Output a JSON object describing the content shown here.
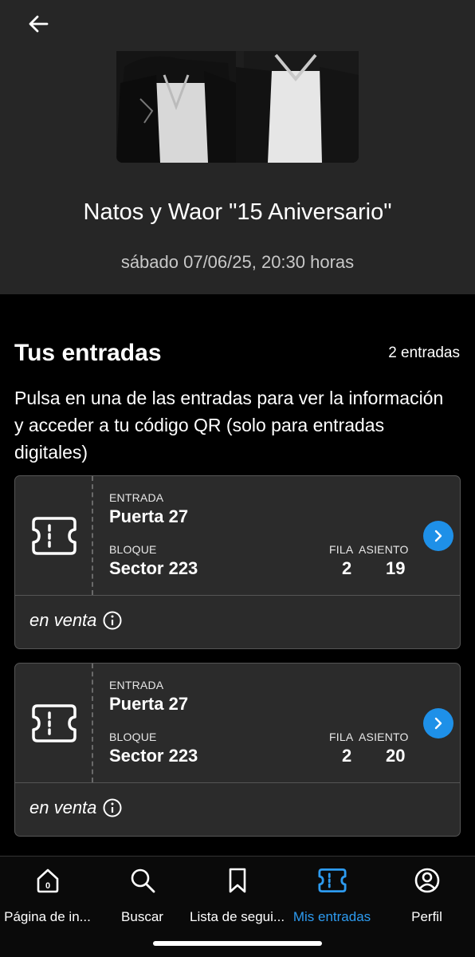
{
  "header": {
    "event_title": "Natos y Waor \"15 Aniversario\"",
    "event_date": "sábado 07/06/25, 20:30 horas"
  },
  "tickets_section": {
    "title": "Tus entradas",
    "count": "2 entradas",
    "instructions": "Pulsa en una de las entradas para ver la información y acceder a tu código QR (solo para entradas digitales)"
  },
  "tickets": [
    {
      "entrada_label": "ENTRADA",
      "entrada_value": "Puerta 27",
      "bloque_label": "BLOQUE",
      "bloque_value": "Sector 223",
      "fila_label": "FILA",
      "fila_value": "2",
      "asiento_label": "ASIENTO",
      "asiento_value": "19",
      "status": "en venta"
    },
    {
      "entrada_label": "ENTRADA",
      "entrada_value": "Puerta 27",
      "bloque_label": "BLOQUE",
      "bloque_value": "Sector 223",
      "fila_label": "FILA",
      "fila_value": "2",
      "asiento_label": "ASIENTO",
      "asiento_value": "20",
      "status": "en venta"
    }
  ],
  "nav": {
    "items": [
      {
        "label": "Página de in...",
        "icon": "home-icon"
      },
      {
        "label": "Buscar",
        "icon": "search-icon"
      },
      {
        "label": "Lista de segui...",
        "icon": "bookmark-icon"
      },
      {
        "label": "Mis entradas",
        "icon": "ticket-icon",
        "active": true
      },
      {
        "label": "Perfil",
        "icon": "profile-icon"
      }
    ]
  },
  "colors": {
    "accent": "#2d9bf0",
    "arrow_button": "#1e90e8",
    "header_bg": "#262626",
    "card_bg": "#2b2b2b"
  }
}
